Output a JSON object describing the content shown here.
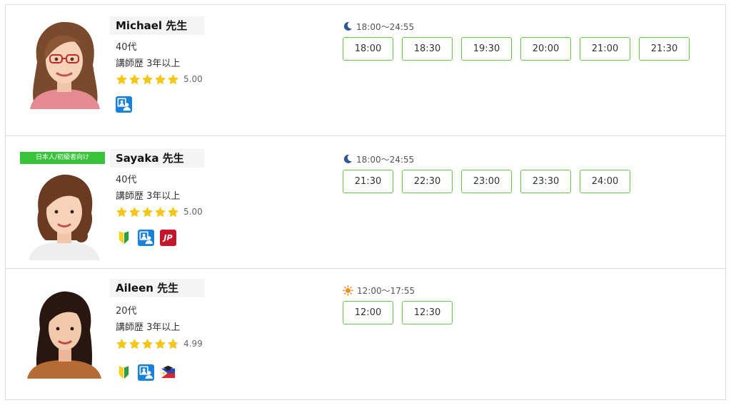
{
  "teachers": [
    {
      "name": "Michael 先生",
      "age": "40代",
      "experience": "講師歴  3年以上",
      "rating": "5.00",
      "rating_value": 5.0,
      "icons": [
        "online-lesson-icon"
      ],
      "time_range": "18:00〜24:55",
      "time_icon": "moon-icon",
      "slots": [
        "18:00",
        "18:30",
        "19:30",
        "20:00",
        "21:00",
        "21:30"
      ]
    },
    {
      "badge": "日本人/初級者向け",
      "name": "Sayaka 先生",
      "age": "40代",
      "experience": "講師歴  3年以上",
      "rating": "5.00",
      "rating_value": 5.0,
      "icons": [
        "beginner-mark-icon",
        "online-lesson-icon",
        "japanese-icon"
      ],
      "jp_label": "JP",
      "time_range": "18:00〜24:55",
      "time_icon": "moon-icon",
      "slots": [
        "21:30",
        "22:30",
        "23:00",
        "23:30",
        "24:00"
      ]
    },
    {
      "name": "Aileen 先生",
      "age": "20代",
      "experience": "講師歴  3年以上",
      "rating": "4.99",
      "rating_value": 4.99,
      "icons": [
        "beginner-mark-icon",
        "online-lesson-icon",
        "philippines-graduate-icon"
      ],
      "time_range": "12:00〜17:55",
      "time_icon": "sun-icon",
      "slots": [
        "12:00",
        "12:30"
      ]
    }
  ],
  "colors": {
    "slot_border": "#66c54a",
    "badge_bg": "#39c33a",
    "star": "#f5c518",
    "moon": "#2f5597",
    "sun": "#f08c1e",
    "icon_blue": "#1a82d6",
    "jp_red": "#c4162a"
  }
}
